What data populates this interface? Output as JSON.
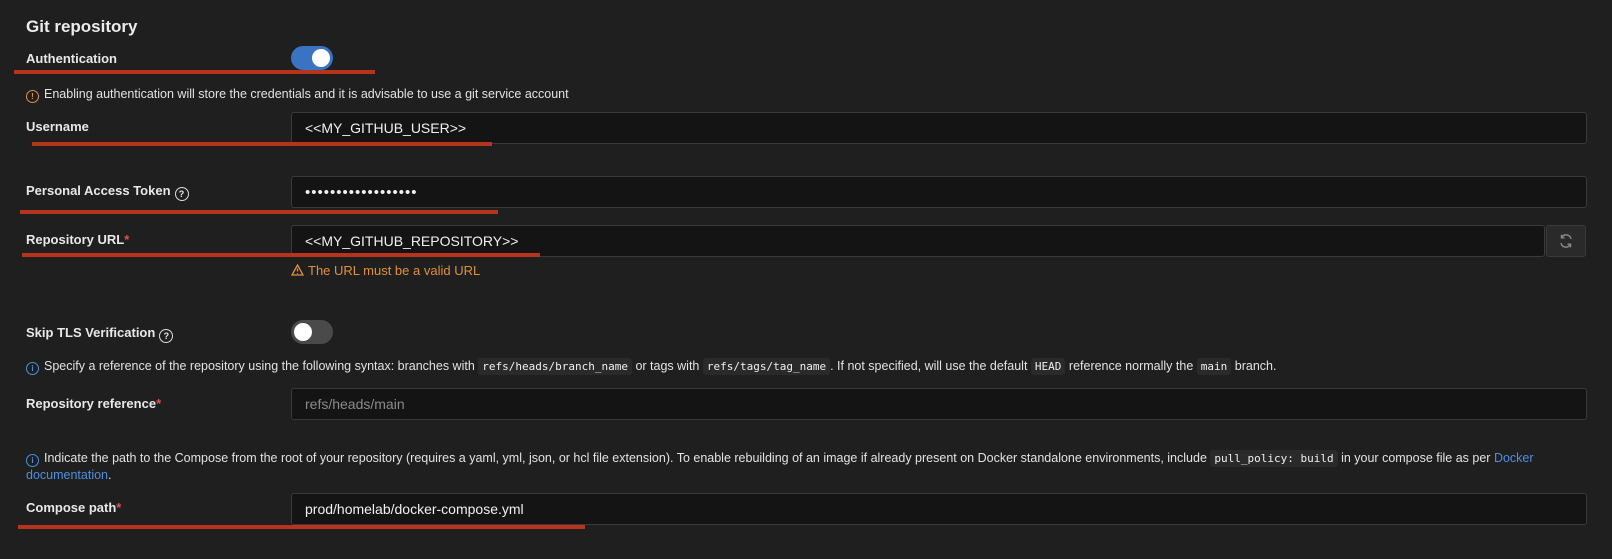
{
  "section": {
    "title": "Git repository"
  },
  "authentication": {
    "label": "Authentication",
    "enabled": true
  },
  "auth_notice": "Enabling authentication will store the credentials and it is advisable to use a git service account",
  "username": {
    "label": "Username",
    "value": "<<MY_GITHUB_USER>>"
  },
  "token": {
    "label": "Personal Access Token",
    "value": "••••••••••••••••••"
  },
  "repo_url": {
    "label": "Repository URL",
    "required_mark": "*",
    "value": "<<MY_GITHUB_REPOSITORY>>",
    "error": "The URL must be a valid URL"
  },
  "skip_tls": {
    "label": "Skip TLS Verification",
    "enabled": false
  },
  "reference_info": {
    "t1": "Specify a reference of the repository using the following syntax: branches with",
    "c1": "refs/heads/branch_name",
    "t2": "or tags with",
    "c2": "refs/tags/tag_name",
    "t3": ". If not specified, will use the default",
    "c3": "HEAD",
    "t4": "reference normally the",
    "c4": "main",
    "t5": "branch."
  },
  "repo_reference": {
    "label": "Repository reference",
    "required_mark": "*",
    "placeholder": "refs/heads/main"
  },
  "compose_info": {
    "t1": "Indicate the path to the Compose from the root of your repository (requires a yaml, yml, json, or hcl file extension).  To enable rebuilding of an image if already present on Docker standalone environments, include",
    "c1": "pull_policy: build",
    "t2": "in your compose file as per",
    "link": "Docker documentation",
    "t3": "."
  },
  "compose_path": {
    "label": "Compose path",
    "required_mark": "*",
    "value": "prod/homelab/docker-compose.yml"
  },
  "colors": {
    "accent": "#3a73c4",
    "warning": "#e0903a",
    "annotation": "#b5351c",
    "required": "#e05252"
  },
  "icons": {
    "info": "info-circle-icon",
    "warning": "warning-triangle-icon",
    "help": "question-circle-icon",
    "refresh": "refresh-icon"
  }
}
